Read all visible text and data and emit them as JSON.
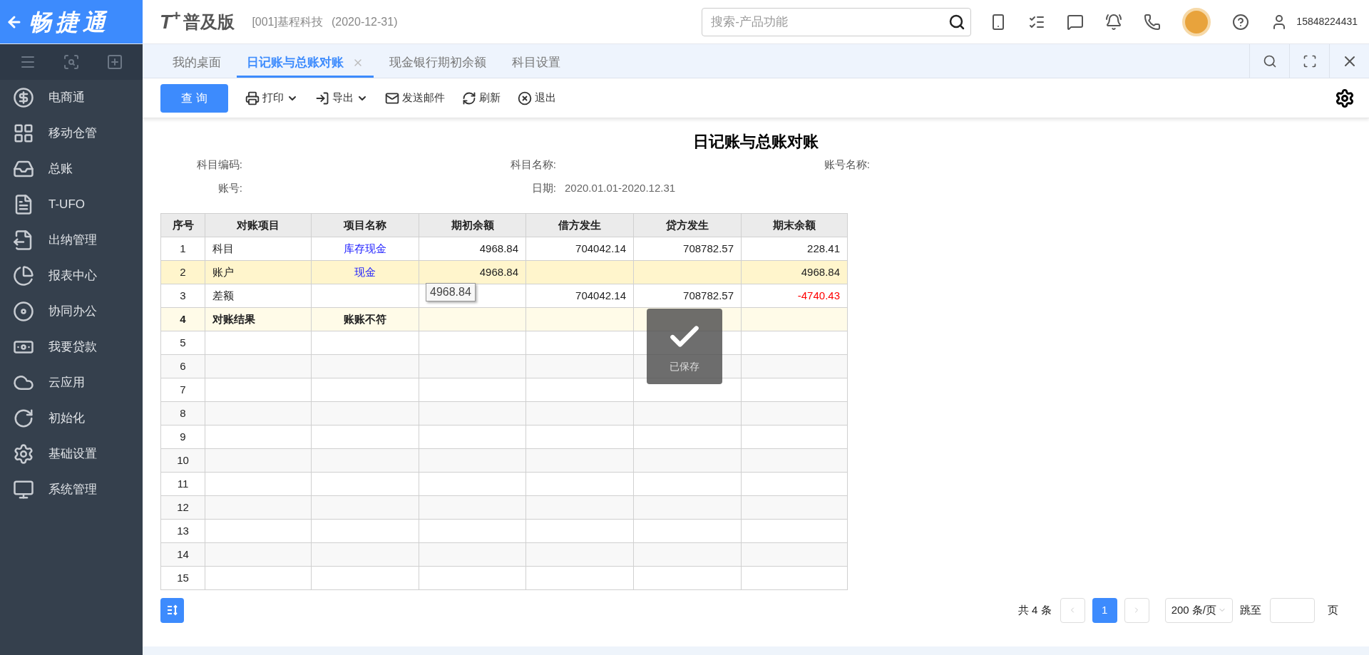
{
  "brand": {
    "logo": "畅捷通",
    "product_mark": "T$^{+}$",
    "edition": "普及版",
    "company": "[001]基程科技",
    "date": "(2020-12-31)"
  },
  "search": {
    "placeholder": "搜索-产品功能"
  },
  "user": {
    "phone": "15848224431"
  },
  "sidebar": {
    "items": [
      {
        "label": "电商通",
        "kind": "shop"
      },
      {
        "label": "移动仓管",
        "kind": "grid"
      },
      {
        "label": "总账",
        "kind": "ledger"
      },
      {
        "label": "T-UFO",
        "kind": "file"
      },
      {
        "label": "出纳管理",
        "kind": "cashier"
      },
      {
        "label": "报表中心",
        "kind": "report"
      },
      {
        "label": "协同办公",
        "kind": "office"
      },
      {
        "label": "我要贷款",
        "kind": "loan"
      },
      {
        "label": "云应用",
        "kind": "cloud"
      },
      {
        "label": "初始化",
        "kind": "init"
      },
      {
        "label": "基础设置",
        "kind": "settings"
      },
      {
        "label": "系统管理",
        "kind": "system"
      }
    ]
  },
  "tabs": [
    {
      "label": "我的桌面",
      "selected": false
    },
    {
      "label": "日记账与总账对账",
      "selected": true
    },
    {
      "label": "现金银行期初余额",
      "selected": false
    },
    {
      "label": "科目设置",
      "selected": false
    }
  ],
  "toolbar": {
    "query": "查 询",
    "actions": [
      {
        "label": "打印",
        "kind": "print",
        "dropdown": true
      },
      {
        "label": "导出",
        "kind": "export",
        "dropdown": true
      },
      {
        "label": "发送邮件",
        "kind": "mail",
        "dropdown": false
      },
      {
        "label": "刷新",
        "kind": "refresh",
        "dropdown": false
      },
      {
        "label": "退出",
        "kind": "exit",
        "dropdown": false
      }
    ]
  },
  "report": {
    "title": "日记账与总账对账",
    "fields": [
      {
        "label": "科目编码:"
      },
      {
        "label": "科目名称:"
      },
      {
        "label": "账号名称:"
      },
      {
        "label": "账号:"
      },
      {
        "label": "日期:",
        "value": "2020.01.01-2020.12.31"
      }
    ]
  },
  "table": {
    "columns": [
      "序号",
      "对账项目",
      "项目名称",
      "期初余额",
      "借方发生",
      "贷方发生",
      "期末余额"
    ],
    "rows": [
      {
        "kind": "normal",
        "cells": [
          {
            "text": "1"
          },
          {
            "text": "科目"
          },
          {
            "text": "库存现金",
            "kind": "link"
          },
          {
            "text": "4968.84"
          },
          {
            "text": "704042.14"
          },
          {
            "text": "708782.57"
          },
          {
            "text": "228.41"
          }
        ]
      },
      {
        "kind": "highlight",
        "cells": [
          {
            "text": "2"
          },
          {
            "text": "账户"
          },
          {
            "text": "现金",
            "kind": "link"
          },
          {
            "text": "4968.84"
          },
          {},
          {},
          {
            "text": "4968.84"
          }
        ]
      },
      {
        "kind": "normal",
        "cells": [
          {
            "text": "3"
          },
          {
            "text": "差额"
          },
          {},
          {},
          {
            "text": "704042.14"
          },
          {
            "text": "708782.57"
          },
          {
            "text": "-4740.43",
            "kind": "negative"
          }
        ]
      },
      {
        "kind": "result",
        "cells": [
          {
            "text": "4"
          },
          {
            "text": "对账结果"
          },
          {
            "text": "账账不符"
          },
          {},
          {},
          {},
          {}
        ]
      },
      {
        "kind": "normal",
        "cells": [
          {
            "text": "5"
          },
          {},
          {},
          {},
          {},
          {},
          {}
        ]
      },
      {
        "kind": "normal",
        "cells": [
          {
            "text": "6"
          },
          {},
          {},
          {},
          {},
          {},
          {}
        ]
      },
      {
        "kind": "normal",
        "cells": [
          {
            "text": "7"
          },
          {},
          {},
          {},
          {},
          {},
          {}
        ]
      },
      {
        "kind": "normal",
        "cells": [
          {
            "text": "8"
          },
          {},
          {},
          {},
          {},
          {},
          {}
        ]
      },
      {
        "kind": "normal",
        "cells": [
          {
            "text": "9"
          },
          {},
          {},
          {},
          {},
          {},
          {}
        ]
      },
      {
        "kind": "normal",
        "cells": [
          {
            "text": "10"
          },
          {},
          {},
          {},
          {},
          {},
          {}
        ]
      },
      {
        "kind": "normal",
        "cells": [
          {
            "text": "11"
          },
          {},
          {},
          {},
          {},
          {},
          {}
        ]
      },
      {
        "kind": "normal",
        "cells": [
          {
            "text": "12"
          },
          {},
          {},
          {},
          {},
          {},
          {}
        ]
      },
      {
        "kind": "normal",
        "cells": [
          {
            "text": "13"
          },
          {},
          {},
          {},
          {},
          {},
          {}
        ]
      },
      {
        "kind": "normal",
        "cells": [
          {
            "text": "14"
          },
          {},
          {},
          {},
          {},
          {},
          {}
        ]
      },
      {
        "kind": "normal",
        "cells": [
          {
            "text": "15"
          },
          {},
          {},
          {},
          {},
          {},
          {}
        ]
      }
    ]
  },
  "tooltip": {
    "text": "4968.84"
  },
  "toast": {
    "text": "已保存"
  },
  "pagination": {
    "total": "共 4 条",
    "pages": [
      {
        "label": "1",
        "selected": true
      }
    ],
    "page_size": "200 条/页",
    "jump_label": "跳至",
    "page_unit": "页"
  }
}
